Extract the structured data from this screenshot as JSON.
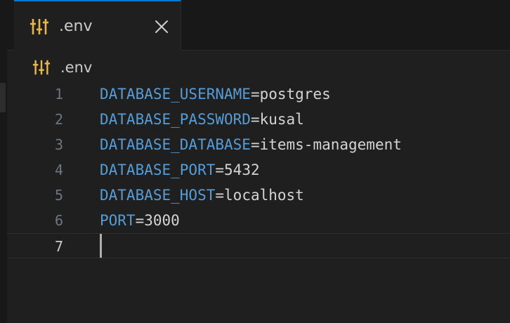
{
  "tab": {
    "label": ".env",
    "icon": "settings-sliders-icon",
    "close_icon": "close-icon"
  },
  "breadcrumb": {
    "label": ".env",
    "icon": "settings-sliders-icon"
  },
  "editor": {
    "active_line": "7",
    "lines": [
      {
        "number": "1",
        "key": "DATABASE_USERNAME",
        "eq": "=",
        "value": "postgres"
      },
      {
        "number": "2",
        "key": "DATABASE_PASSWORD",
        "eq": "=",
        "value": "kusal"
      },
      {
        "number": "3",
        "key": "DATABASE_DATABASE",
        "eq": "=",
        "value": "items-management"
      },
      {
        "number": "4",
        "key": "DATABASE_PORT",
        "eq": "=",
        "value": "5432"
      },
      {
        "number": "5",
        "key": "DATABASE_HOST",
        "eq": "=",
        "value": "localhost"
      },
      {
        "number": "6",
        "key": "PORT",
        "eq": "=",
        "value": "3000"
      },
      {
        "number": "7",
        "key": "",
        "eq": "",
        "value": ""
      }
    ]
  },
  "colors": {
    "key": "#569cd6",
    "icon": "#e8b94a",
    "tab_accent": "#0078d4"
  }
}
